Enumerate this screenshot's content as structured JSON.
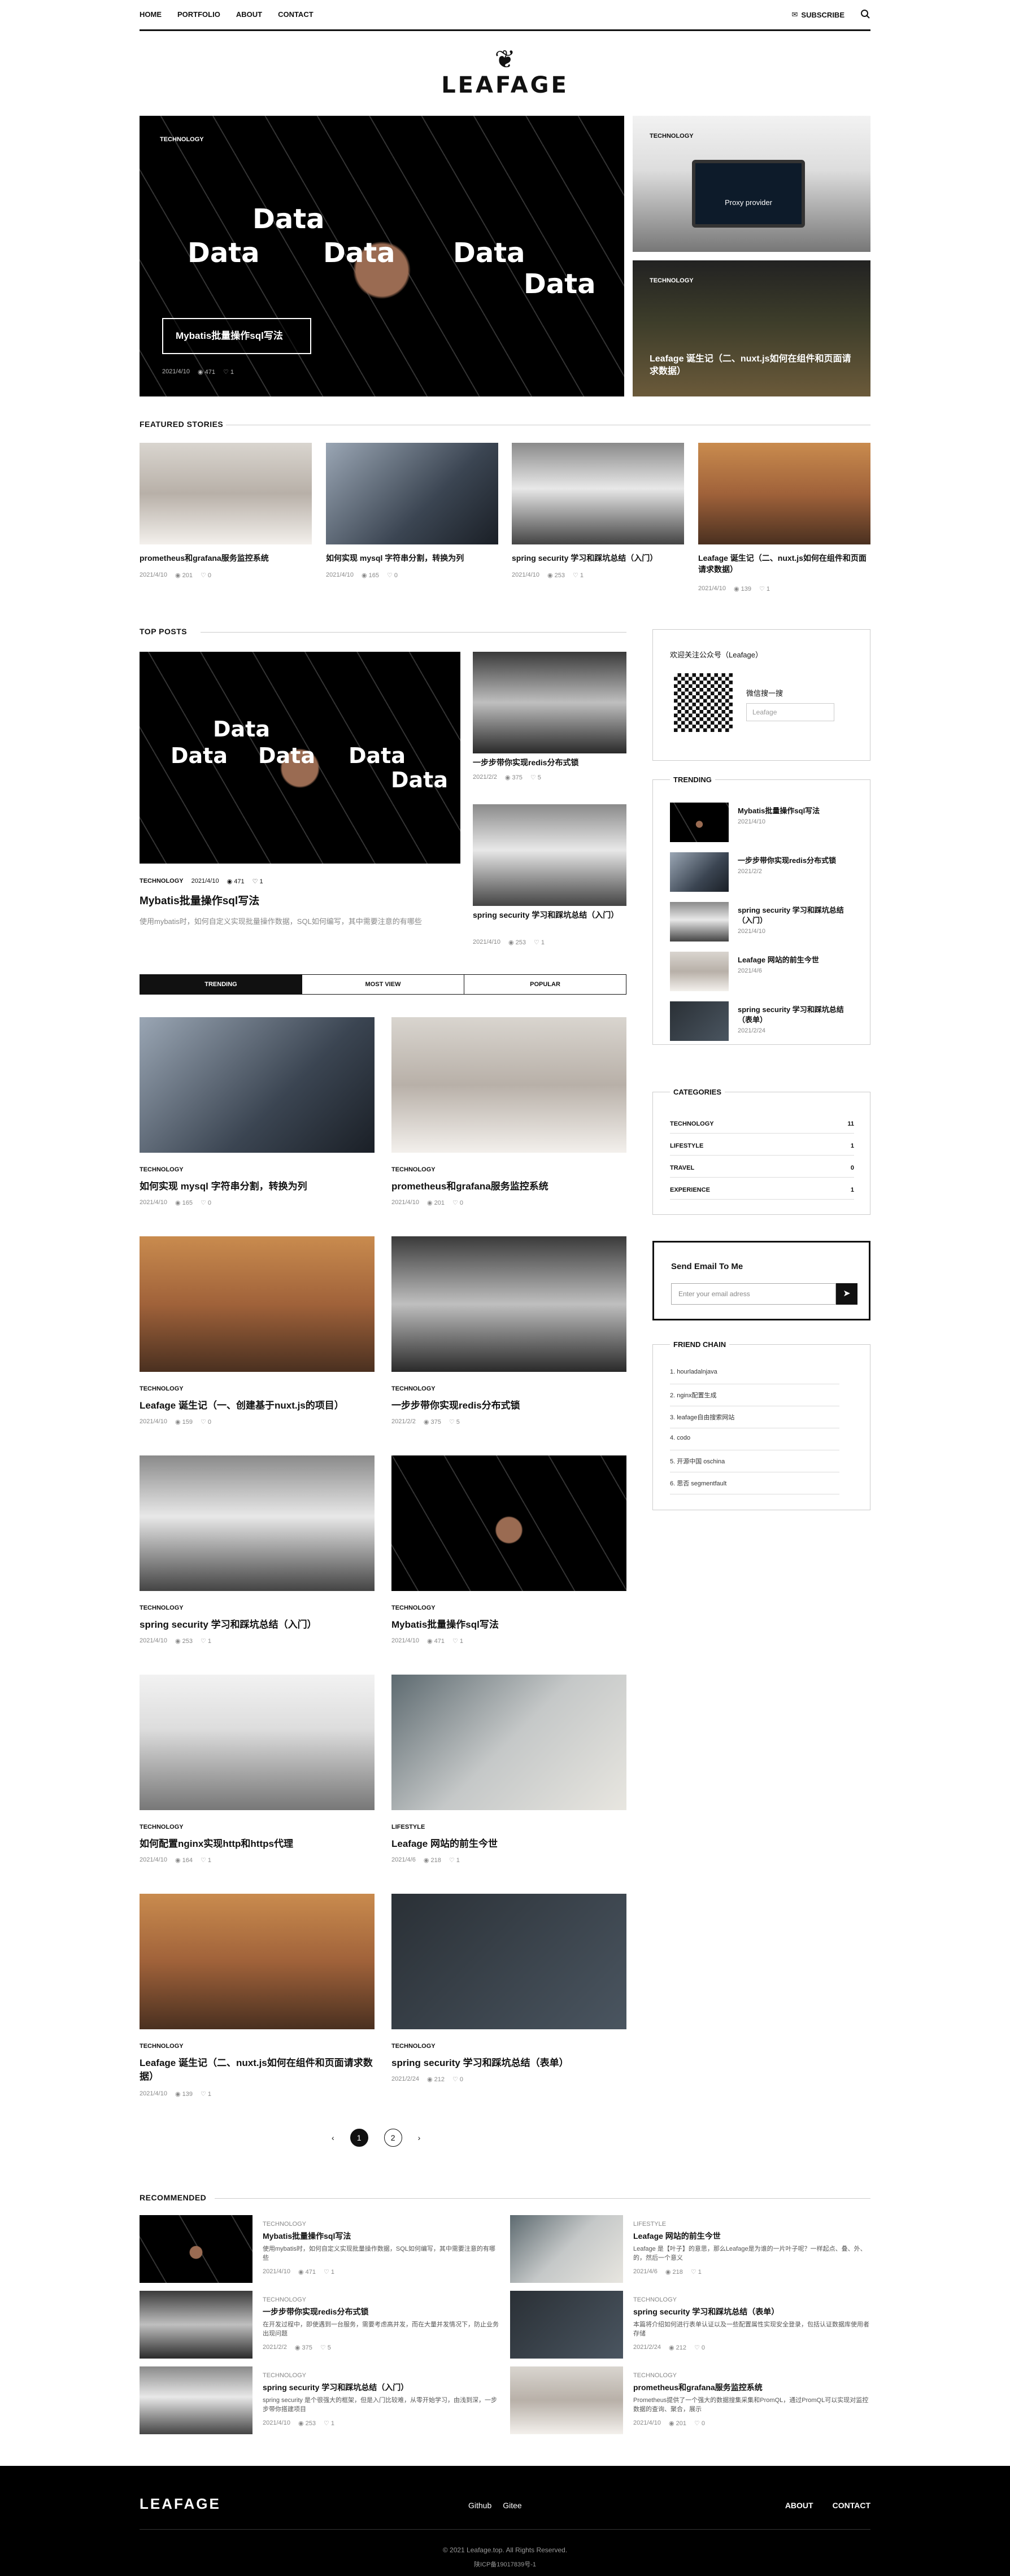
{
  "nav": {
    "links": [
      "HOME",
      "PORTFOLIO",
      "ABOUT",
      "CONTACT"
    ],
    "subscribe": "SUBSCRIBE"
  },
  "logo": "LEAFAGE",
  "hero": {
    "main": {
      "category": "TECHNOLOGY",
      "title": "Mybatis批量操作sql写法",
      "date": "2021/4/10",
      "views": "471",
      "likes": "1",
      "words": [
        "Data",
        "Data",
        "Data",
        "Data",
        "Data"
      ]
    },
    "right1": {
      "category": "TECHNOLOGY",
      "screen": "Proxy provider"
    },
    "right2": {
      "category": "TECHNOLOGY",
      "title": "Leafage 诞生记（二、nuxt.js如何在组件和页面请求数据）"
    }
  },
  "featured": {
    "heading": "FEATURED STORIES",
    "items": [
      {
        "title": "prometheus和grafana服务监控系统",
        "date": "2021/4/10",
        "views": "201",
        "likes": "0"
      },
      {
        "title": "如何实现 mysql 字符串分割，转换为列",
        "date": "2021/4/10",
        "views": "165",
        "likes": "0"
      },
      {
        "title": "spring security 学习和踩坑总结（入门）",
        "date": "2021/4/10",
        "views": "253",
        "likes": "1"
      },
      {
        "title": "Leafage 诞生记（二、nuxt.js如何在组件和页面请求数据）",
        "date": "2021/4/10",
        "views": "139",
        "likes": "1"
      }
    ]
  },
  "top": {
    "heading": "TOP POSTS",
    "main": {
      "category": "TECHNOLOGY",
      "date": "2021/4/10",
      "views": "471",
      "likes": "1",
      "title": "Mybatis批量操作sql写法",
      "excerpt": "使用mybatis时，如何自定义实现批量操作数据，SQL如何编写，其中需要注意的有哪些"
    },
    "side": [
      {
        "title": "一步步带你实现redis分布式锁",
        "date": "2021/2/2",
        "views": "375",
        "likes": "5"
      },
      {
        "title": "spring security 学习和踩坑总结（入门）",
        "date": "2021/4/10",
        "views": "253",
        "likes": "1"
      }
    ]
  },
  "tabs": [
    "TRENDING",
    "MOST VIEW",
    "POPULAR"
  ],
  "grid": [
    {
      "category": "TECHNOLOGY",
      "title": "如何实现 mysql 字符串分割，转换为列",
      "date": "2021/4/10",
      "views": "165",
      "likes": "0"
    },
    {
      "category": "TECHNOLOGY",
      "title": "prometheus和grafana服务监控系统",
      "date": "2021/4/10",
      "views": "201",
      "likes": "0"
    },
    {
      "category": "TECHNOLOGY",
      "title": "Leafage 诞生记（一、创建基于nuxt.js的项目）",
      "date": "2021/4/10",
      "views": "159",
      "likes": "0"
    },
    {
      "category": "TECHNOLOGY",
      "title": "一步步带你实现redis分布式锁",
      "date": "2021/2/2",
      "views": "375",
      "likes": "5"
    },
    {
      "category": "TECHNOLOGY",
      "title": "spring security 学习和踩坑总结（入门）",
      "date": "2021/4/10",
      "views": "253",
      "likes": "1"
    },
    {
      "category": "TECHNOLOGY",
      "title": "Mybatis批量操作sql写法",
      "date": "2021/4/10",
      "views": "471",
      "likes": "1"
    },
    {
      "category": "TECHNOLOGY",
      "title": "如何配置nginx实现http和https代理",
      "date": "2021/4/10",
      "views": "164",
      "likes": "1"
    },
    {
      "category": "LIFESTYLE",
      "title": "Leafage 网站的前生今世",
      "date": "2021/4/6",
      "views": "218",
      "likes": "1"
    },
    {
      "category": "TECHNOLOGY",
      "title": "Leafage 诞生记（二、nuxt.js如何在组件和页面请求数据）",
      "date": "2021/4/10",
      "views": "139",
      "likes": "1"
    },
    {
      "category": "TECHNOLOGY",
      "title": "spring security 学习和踩坑总结（表单）",
      "date": "2021/2/24",
      "views": "212",
      "likes": "0"
    }
  ],
  "pagination": {
    "prev": "‹",
    "pages": [
      "1",
      "2"
    ],
    "next": "›"
  },
  "sidebar": {
    "wechat": {
      "title": "欢迎关注公众号（Leafage）",
      "search": "微信搜一搜",
      "name": "Leafage"
    },
    "trending": {
      "heading": "TRENDING",
      "items": [
        {
          "title": "Mybatis批量操作sql写法",
          "date": "2021/4/10"
        },
        {
          "title": "一步步带你实现redis分布式锁",
          "date": "2021/2/2"
        },
        {
          "title": "spring security 学习和踩坑总结（入门）",
          "date": "2021/4/10"
        },
        {
          "title": "Leafage 网站的前生今世",
          "date": "2021/4/6"
        },
        {
          "title": "spring security 学习和踩坑总结（表单）",
          "date": "2021/2/24"
        }
      ]
    },
    "categories": {
      "heading": "CATEGORIES",
      "items": [
        {
          "name": "TECHNOLOGY",
          "count": "11"
        },
        {
          "name": "LIFESTYLE",
          "count": "1"
        },
        {
          "name": "TRAVEL",
          "count": "0"
        },
        {
          "name": "EXPERIENCE",
          "count": "1"
        }
      ]
    },
    "email": {
      "title": "Send Email To Me",
      "placeholder": "Enter your email adress"
    },
    "friends": {
      "heading": "FRIEND CHAIN",
      "items": [
        "1. hourladalnjava",
        "2. nginx配置生成",
        "3. leafage自由搜索网站",
        "4. codo",
        "5. 开源中国 oschina",
        "6. 思否 segmentfault"
      ]
    }
  },
  "recommended": {
    "heading": "RECOMMENDED",
    "items": [
      {
        "category": "TECHNOLOGY",
        "title": "Mybatis批量操作sql写法",
        "excerpt": "使用mybatis时，如何自定义实现批量操作数据，SQL如何编写，其中需要注意的有哪些",
        "date": "2021/4/10",
        "views": "471",
        "likes": "1"
      },
      {
        "category": "LIFESTYLE",
        "title": "Leafage 网站的前生今世",
        "excerpt": "Leafage 是【叶子】的意思，那么Leafage是为谁的一片叶子呢？一样起点、叠、外、的，然后一个意义",
        "date": "2021/4/6",
        "views": "218",
        "likes": "1"
      },
      {
        "category": "TECHNOLOGY",
        "title": "一步步带你实现redis分布式锁",
        "excerpt": "在开发过程中，即使遇到一台服务，需要考虑高并发，而在大量并发情况下，防止业务出现问题",
        "date": "2021/2/2",
        "views": "375",
        "likes": "5"
      },
      {
        "category": "TECHNOLOGY",
        "title": "spring security 学习和踩坑总结（表单）",
        "excerpt": "本篇将介绍如何进行表单认证以及一些配置属性实现安全登录，包括认证数据库使用者存储",
        "date": "2021/2/24",
        "views": "212",
        "likes": "0"
      },
      {
        "category": "TECHNOLOGY",
        "title": "spring security 学习和踩坑总结（入门）",
        "excerpt": "spring security 是个很强大的框架，但是入门比较难，从零开始学习，由浅到深，一步步带你搭建项目",
        "date": "2021/4/10",
        "views": "253",
        "likes": "1"
      },
      {
        "category": "TECHNOLOGY",
        "title": "prometheus和grafana服务监控系统",
        "excerpt": "Prometheus提供了一个强大的数据搜集采集和PromQL，通过PromQL可以实现对监控数据的查询、聚合，展示",
        "date": "2021/4/10",
        "views": "201",
        "likes": "0"
      }
    ]
  },
  "footer": {
    "logo": "LEAFAGE",
    "links": [
      "Github",
      "Gitee"
    ],
    "right": [
      "ABOUT",
      "CONTACT"
    ],
    "copyright": "© 2021 Leafage.top. All Rights Reserved.",
    "icp": "陕ICP备19017839号-1"
  }
}
